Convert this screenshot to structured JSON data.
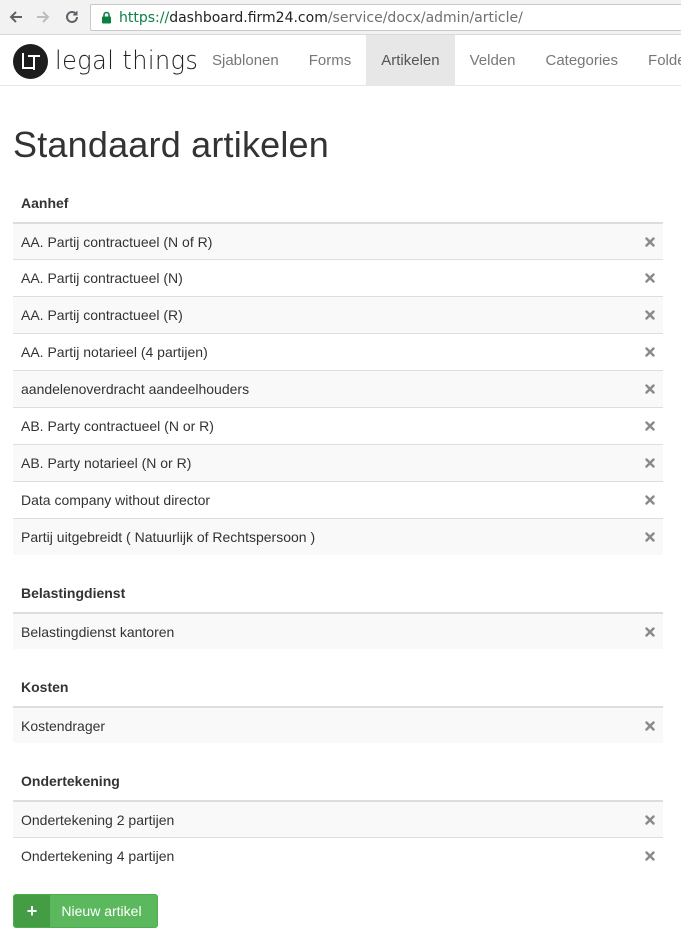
{
  "browser": {
    "url_scheme": "https://",
    "url_host": "dashboard.firm24.com",
    "url_path": "/service/docx/admin/article/"
  },
  "navbar": {
    "brand_text": "legal things",
    "items": [
      {
        "label": "Sjablonen",
        "active": false
      },
      {
        "label": "Forms",
        "active": false
      },
      {
        "label": "Artikelen",
        "active": true
      },
      {
        "label": "Velden",
        "active": false
      },
      {
        "label": "Categories",
        "active": false
      },
      {
        "label": "Folders",
        "active": false
      }
    ]
  },
  "page_title": "Standaard artikelen",
  "sections": [
    {
      "title": "Aanhef",
      "items": [
        "AA. Partij contractueel (N of R)",
        "AA. Partij contractueel (N)",
        "AA. Partij contractueel (R)",
        "AA. Partij notarieel (4 partijen)",
        "aandelenoverdracht aandeelhouders",
        "AB. Party contractueel (N or R)",
        "AB. Party notarieel (N or R)",
        "Data company without director",
        "Partij uitgebreidt ( Natuurlijk of Rechtspersoon )"
      ]
    },
    {
      "title": "Belastingdienst",
      "items": [
        "Belastingdienst kantoren"
      ]
    },
    {
      "title": "Kosten",
      "items": [
        "Kostendrager"
      ]
    },
    {
      "title": "Ondertekening",
      "items": [
        "Ondertekening 2 partijen",
        "Ondertekening 4 partijen"
      ]
    }
  ],
  "new_button": {
    "icon": "+",
    "label": "Nieuw artikel"
  },
  "colors": {
    "accent_green": "#5cb85c",
    "active_nav": "#e7e7e7"
  }
}
